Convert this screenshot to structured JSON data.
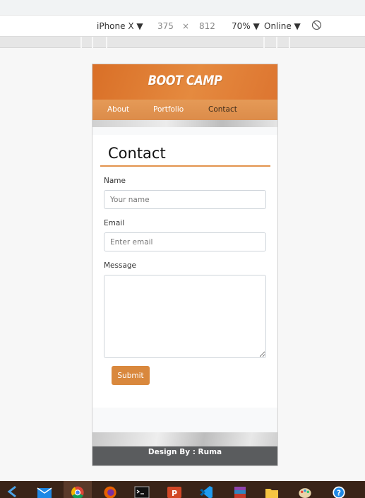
{
  "devtools": {
    "device": "iPhone X ▼",
    "width": "375",
    "times": "×",
    "height": "812",
    "zoom": "70% ▼",
    "network": "Online ▼"
  },
  "site": {
    "logo": "BOOT CAMP",
    "nav": [
      "About",
      "Portfolio",
      "Contact"
    ],
    "active_nav": "Contact"
  },
  "form": {
    "title": "Contact",
    "name_label": "Name",
    "name_placeholder": "Your name",
    "email_label": "Email",
    "email_placeholder": "Enter email",
    "message_label": "Message",
    "submit_label": "Submit"
  },
  "footer": {
    "text": "Design By : Ruma"
  },
  "colors": {
    "brand_orange": "#d96f27",
    "nav_orange": "#e59a57",
    "submit": "#d9883d",
    "footer_bg": "#5a5c5e"
  },
  "taskbar_icons": [
    "vscode-arrow-icon",
    "mail-icon",
    "chrome-icon",
    "firefox-icon",
    "terminal-icon",
    "powerpoint-icon",
    "vscode-icon",
    "winrar-icon",
    "file-explorer-icon",
    "paint-icon",
    "help-icon"
  ]
}
